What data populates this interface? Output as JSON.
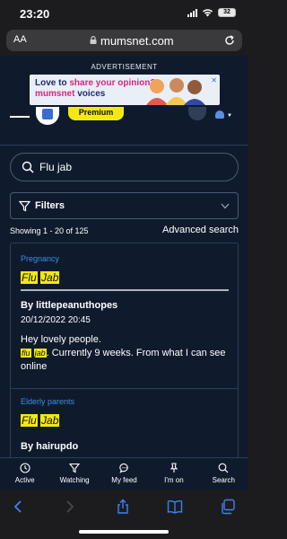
{
  "status": {
    "time": "23:20",
    "battery": "32"
  },
  "browser": {
    "aa_label": "AA",
    "url": "mumsnet.com"
  },
  "ad": {
    "label": "ADVERTISEMENT",
    "line1_a": "Love to ",
    "line1_b": "share your opinion?",
    "line2_a": "mumsnet",
    "line2_b": " voices",
    "close": "✕"
  },
  "header": {
    "premium_label": "Premium"
  },
  "search": {
    "value": "Flu jab"
  },
  "filters": {
    "label": "Filters"
  },
  "results_info": {
    "count": "Showing 1 - 20 of 125",
    "advanced": "Advanced search"
  },
  "results": [
    {
      "topic": "Pregnancy",
      "title_w1": "Flu",
      "title_w2": "Jab",
      "author": "By littlepeanuthopes",
      "date": "20/12/2022 20:45",
      "snippet_pre": "Hey lovely people.",
      "snippet_hl1": "flu",
      "snippet_hl2": "jab",
      "snippet_post": ". Currently 9 weeks. From what I can see online"
    },
    {
      "topic": "Elderly parents",
      "title_w1": "Flu",
      "title_w2": "Jab",
      "author": "By hairupdo"
    }
  ],
  "bottom_nav": [
    {
      "label": "Active",
      "icon": "clock-icon"
    },
    {
      "label": "Watching",
      "icon": "filter-icon"
    },
    {
      "label": "My feed",
      "icon": "chat-icon"
    },
    {
      "label": "I'm on",
      "icon": "pin-icon"
    },
    {
      "label": "Search",
      "icon": "search-icon"
    }
  ],
  "colors": {
    "page_bg": "#0f1b2d",
    "highlight": "#f4e90f",
    "topic_link": "#3c8fe0",
    "safari_accent": "#3b82f6"
  }
}
